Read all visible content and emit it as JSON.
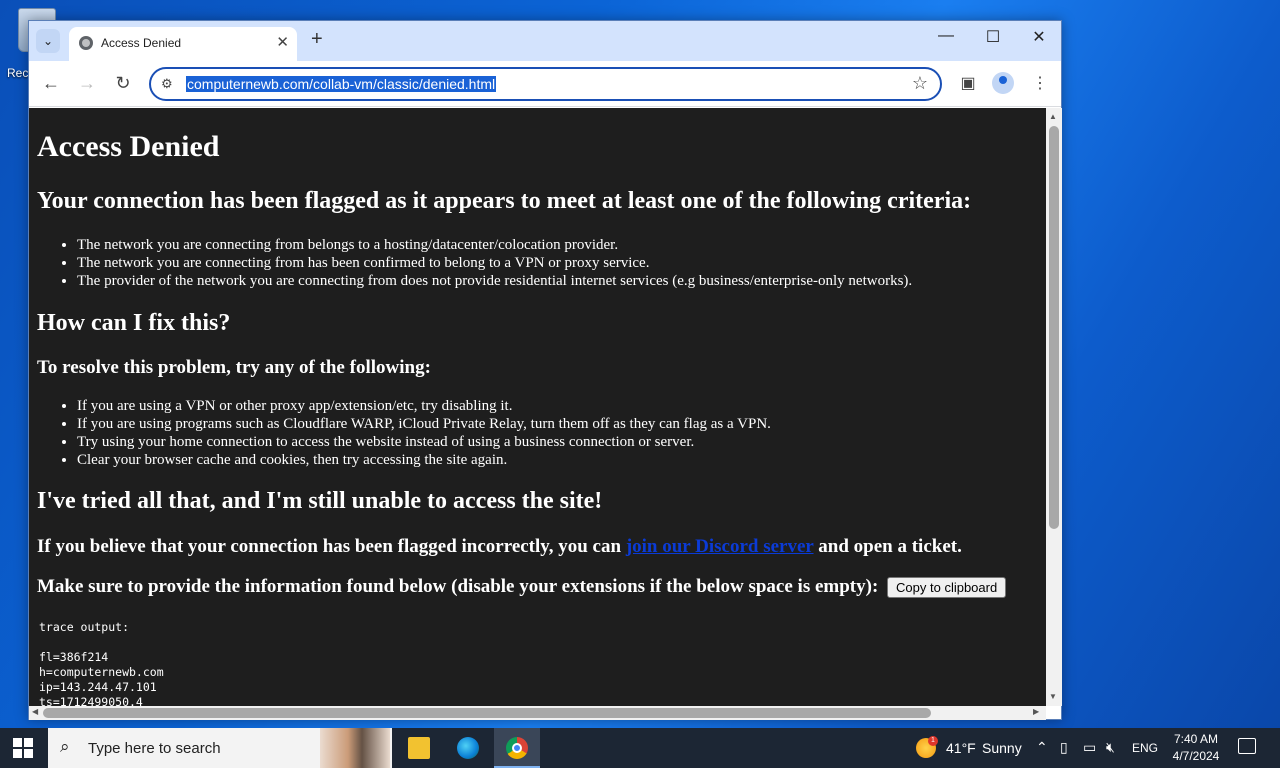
{
  "desktop": {
    "recycle_label": "Rec"
  },
  "browser": {
    "tab_title": "Access Denied",
    "tab_close": "✕",
    "new_tab": "+",
    "url": "computernewb.com/collab-vm/classic/denied.html",
    "controls": {
      "minimize": "—",
      "maximize": "☐",
      "close": "✕"
    }
  },
  "page": {
    "title": "Access Denied",
    "flagged_heading": "Your connection has been flagged as it appears to meet at least one of the following criteria:",
    "criteria": [
      "The network you are connecting from belongs to a hosting/datacenter/colocation provider.",
      "The network you are connecting from has been confirmed to belong to a VPN or proxy service.",
      "The provider of the network you are connecting from does not provide residential internet services (e.g business/enterprise-only networks)."
    ],
    "fix_heading": "How can I fix this?",
    "resolve_heading": "To resolve this problem, try any of the following:",
    "fixes": [
      "If you are using a VPN or other proxy app/extension/etc, try disabling it.",
      "If you are using programs such as Cloudflare WARP, iCloud Private Relay, turn them off as they can flag as a VPN.",
      "Try using your home connection to access the website instead of using a business connection or server.",
      "Clear your browser cache and cookies, then try accessing the site again."
    ],
    "tried_heading": "I've tried all that, and I'm still unable to access the site!",
    "incorrect_prefix": "If you believe that your connection has been flagged incorrectly, you can ",
    "discord_link": "join our Discord server",
    "incorrect_suffix": " and open a ticket.",
    "provide_info": "Make sure to provide the information found below (disable your extensions if the below space is empty):",
    "copy_button": "Copy to clipboard",
    "trace_label": "trace output:",
    "trace_lines": [
      "fl=386f214",
      "h=computernewb.com",
      "ip=143.244.47.101",
      "ts=1712499050.4"
    ]
  },
  "taskbar": {
    "search_placeholder": "Type here to search",
    "weather_badge": "1",
    "weather_temp": "41°F",
    "weather_cond": "Sunny",
    "language": "ENG",
    "time": "7:40 AM",
    "date": "4/7/2024"
  }
}
